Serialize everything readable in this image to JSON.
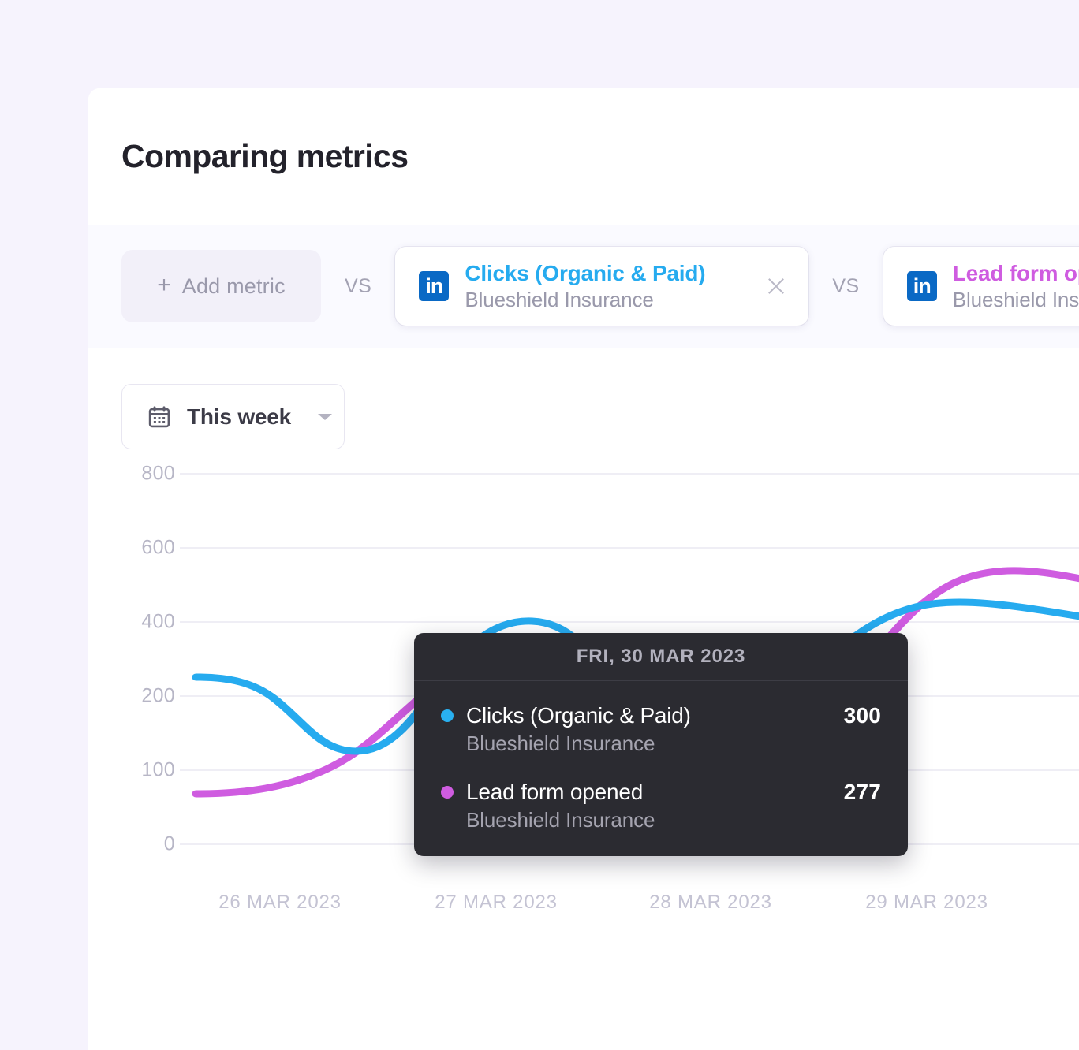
{
  "header": {
    "title": "Comparing metrics"
  },
  "toolbar": {
    "add_metric_label": "Add metric",
    "add_metric_plus": "+",
    "vs_label": "VS",
    "metrics": [
      {
        "icon": "linkedin-icon",
        "name": "Clicks (Organic & Paid)",
        "account": "Blueshield Insurance",
        "color": "#26abef",
        "has_close": true
      },
      {
        "icon": "linkedin-icon",
        "name": "Lead form opened",
        "account": "Blueshield Insurance",
        "color": "#cf5ce0",
        "has_close": false
      }
    ]
  },
  "date_picker": {
    "icon": "calendar-icon",
    "label": "This week",
    "caret": "chevron-down-icon"
  },
  "tooltip": {
    "date": "FRI, 30 MAR 2023",
    "rows": [
      {
        "label": "Clicks (Organic & Paid)",
        "sub": "Blueshield Insurance",
        "value": "300",
        "color": "#29b0f0"
      },
      {
        "label": "Lead form opened",
        "sub": "Blueshield Insurance",
        "value": "277",
        "color": "#cf5ce0"
      }
    ]
  },
  "chart_data": {
    "type": "line",
    "title": "Comparing metrics",
    "xlabel": "",
    "ylabel": "",
    "grid": true,
    "legend": "none",
    "y_ticks": [
      800,
      600,
      400,
      200,
      100,
      0
    ],
    "ylim": [
      0,
      800
    ],
    "x_ticks": [
      "26 MAR 2023",
      "27 MAR 2023",
      "28 MAR 2023",
      "29 MAR 2023"
    ],
    "x": [
      "26 MAR 2023",
      "27 MAR 2023",
      "28 MAR 2023",
      "29 MAR 2023",
      "30 MAR 2023"
    ],
    "series": [
      {
        "name": "Clicks (Organic & Paid)",
        "account": "Blueshield Insurance",
        "color": "#26abef",
        "values": [
          230,
          135,
          400,
          150,
          300
        ]
      },
      {
        "name": "Lead form opened",
        "account": "Blueshield Insurance",
        "color": "#cf5ce0",
        "values": [
          65,
          130,
          345,
          105,
          277
        ]
      }
    ],
    "highlight_point": {
      "x": "30 MAR 2023",
      "clicks_organic_paid": 300,
      "lead_form_opened": 277
    }
  }
}
